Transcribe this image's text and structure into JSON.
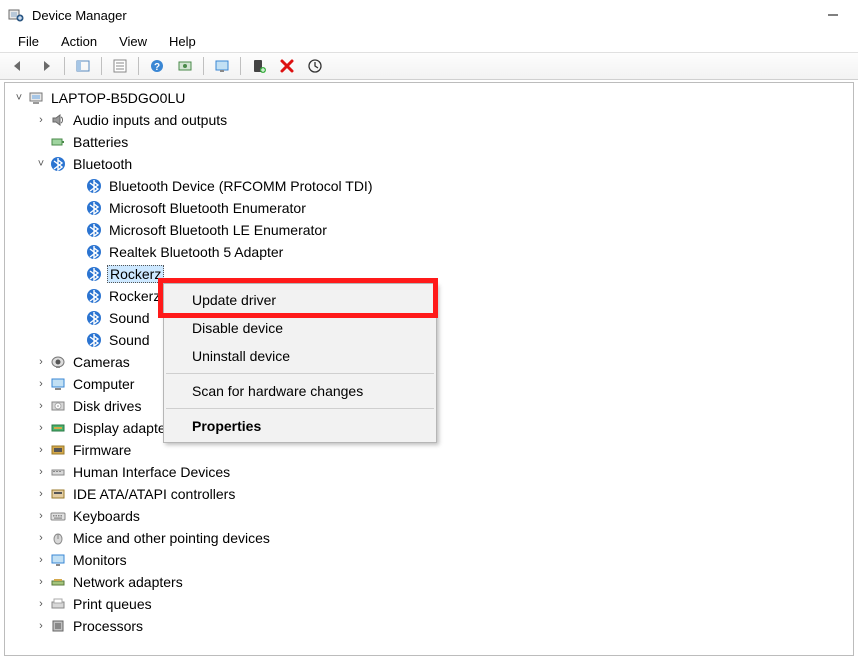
{
  "window": {
    "title": "Device Manager"
  },
  "menu": {
    "file": "File",
    "action": "Action",
    "view": "View",
    "help": "Help"
  },
  "toolbar": {
    "back": "back",
    "forward": "forward",
    "show_hide": "show-hide-console-tree",
    "properties": "properties",
    "help": "help",
    "scan": "scan-for-hardware-changes",
    "monitor": "show-hidden-devices",
    "add_legacy": "add-legacy-hardware",
    "uninstall": "uninstall",
    "update": "update-driver"
  },
  "tree": {
    "root": "LAPTOP-B5DGO0LU",
    "categories": [
      {
        "id": "audio",
        "label": "Audio inputs and outputs",
        "expand": "collapsed"
      },
      {
        "id": "batt",
        "label": "Batteries",
        "expand": "none"
      },
      {
        "id": "bt",
        "label": "Bluetooth",
        "expand": "expanded",
        "children": [
          {
            "label": "Bluetooth Device (RFCOMM Protocol TDI)"
          },
          {
            "label": "Microsoft Bluetooth Enumerator"
          },
          {
            "label": "Microsoft Bluetooth LE Enumerator"
          },
          {
            "label": "Realtek Bluetooth 5 Adapter"
          },
          {
            "label": "Rockerz",
            "selected": true
          },
          {
            "label": "Rockerz"
          },
          {
            "label": "Sound "
          },
          {
            "label": "Sound "
          }
        ]
      },
      {
        "id": "cam",
        "label": "Cameras",
        "expand": "collapsed"
      },
      {
        "id": "comp",
        "label": "Computer",
        "expand": "collapsed"
      },
      {
        "id": "disk",
        "label": "Disk drives",
        "expand": "collapsed"
      },
      {
        "id": "disp",
        "label": "Display adapters",
        "expand": "collapsed"
      },
      {
        "id": "fw",
        "label": "Firmware",
        "expand": "collapsed"
      },
      {
        "id": "hid",
        "label": "Human Interface Devices",
        "expand": "collapsed"
      },
      {
        "id": "ide",
        "label": "IDE ATA/ATAPI controllers",
        "expand": "collapsed"
      },
      {
        "id": "kbd",
        "label": "Keyboards",
        "expand": "collapsed"
      },
      {
        "id": "mouse",
        "label": "Mice and other pointing devices",
        "expand": "collapsed"
      },
      {
        "id": "mon",
        "label": "Monitors",
        "expand": "collapsed"
      },
      {
        "id": "net",
        "label": "Network adapters",
        "expand": "collapsed"
      },
      {
        "id": "printq",
        "label": "Print queues",
        "expand": "collapsed"
      },
      {
        "id": "proc",
        "label": "Processors",
        "expand": "collapsed"
      }
    ]
  },
  "context_menu": {
    "update": "Update driver",
    "disable": "Disable device",
    "uninstall": "Uninstall device",
    "scan": "Scan for hardware changes",
    "properties": "Properties"
  }
}
